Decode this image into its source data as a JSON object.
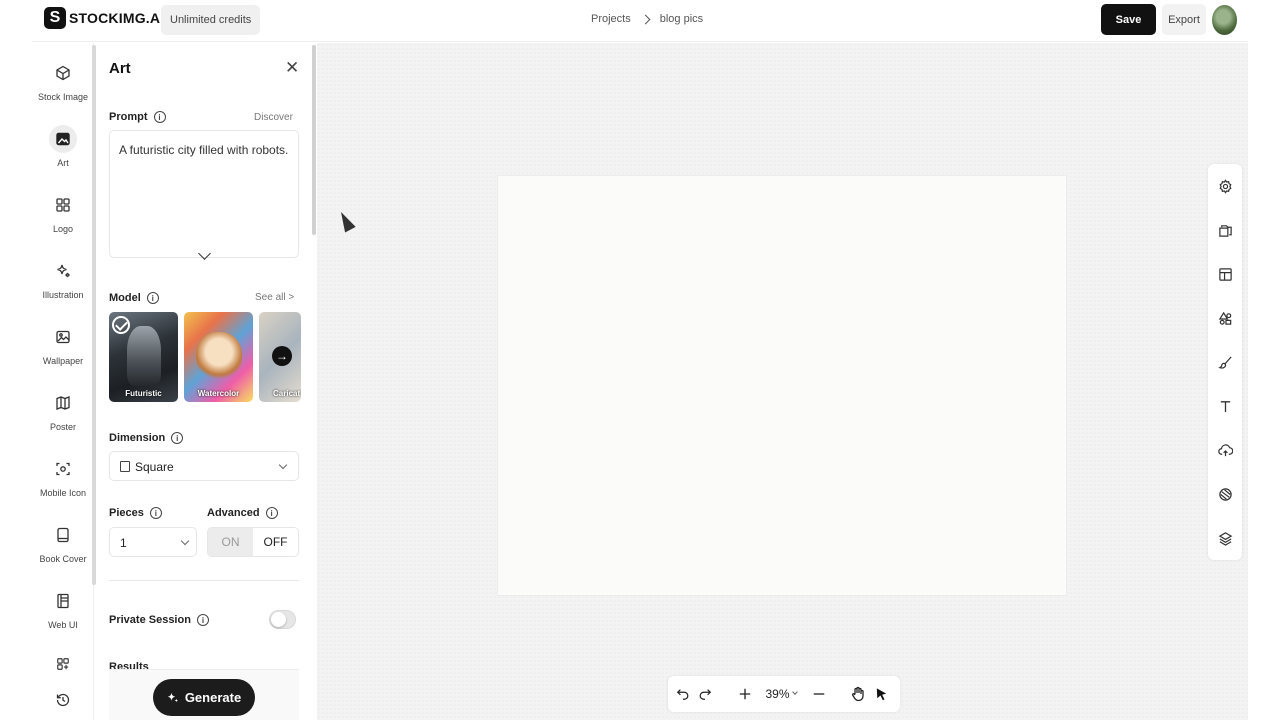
{
  "header": {
    "logo_letter": "S",
    "logo_text": "STOCKIMG.AI",
    "credits": "Unlimited credits",
    "breadcrumb": [
      "Projects",
      "blog pics"
    ],
    "save_label": "Save",
    "export_label": "Export"
  },
  "nav": {
    "items": [
      {
        "label": "Stock Image",
        "icon": "cube-icon"
      },
      {
        "label": "Art",
        "icon": "image-icon",
        "active": true
      },
      {
        "label": "Logo",
        "icon": "grid-icon"
      },
      {
        "label": "Illustration",
        "icon": "sparkle-icon"
      },
      {
        "label": "Wallpaper",
        "icon": "picture-icon"
      },
      {
        "label": "Poster",
        "icon": "map-icon"
      },
      {
        "label": "Mobile Icon",
        "icon": "app-icon"
      },
      {
        "label": "Book Cover",
        "icon": "book-icon"
      },
      {
        "label": "Web UI",
        "icon": "web-icon"
      }
    ]
  },
  "panel": {
    "title": "Art",
    "prompt_label": "Prompt",
    "discover": "Discover",
    "prompt_text": "A futuristic city filled with robots.",
    "model_label": "Model",
    "see_all": "See all >",
    "models": [
      {
        "name": "Futuristic",
        "selected": true
      },
      {
        "name": "Watercolor"
      },
      {
        "name": "Caricat"
      }
    ],
    "dimension_label": "Dimension",
    "dimension_value": "Square",
    "pieces_label": "Pieces",
    "pieces_value": "1",
    "advanced_label": "Advanced",
    "advanced_on": "ON",
    "advanced_off": "OFF",
    "private_label": "Private Session",
    "results_label": "Results",
    "generate_label": "Generate"
  },
  "canvas": {
    "zoom": "39%"
  },
  "colors": {
    "primary_dark": "#111111",
    "canvas_bg": "#f3f3f3",
    "artboard": "#fbfbfa"
  }
}
